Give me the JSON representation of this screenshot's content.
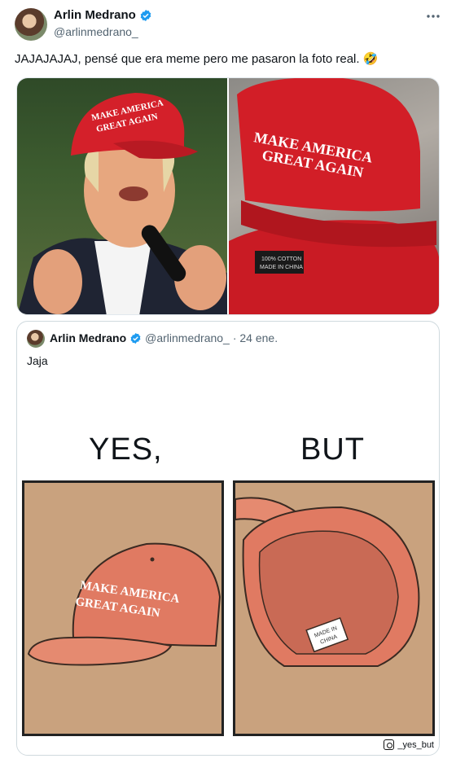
{
  "tweet": {
    "author_name": "Arlin Medrano",
    "handle": "@arlinmedrano_",
    "text": "JAJAJAJAJ, pensé que era meme pero me pasaron la foto real. 🤣",
    "more_icon": "more-icon",
    "verified_icon": "verified-badge-icon",
    "photos": [
      {
        "name": "man-speaking-in-red-cap",
        "cap_text": [
          "MAKE AMERICA",
          "GREAT AGAIN"
        ]
      },
      {
        "name": "red-cap-with-tag",
        "cap_text": [
          "MAKE AMERICA",
          "GREAT AGAIN"
        ],
        "tag_text": [
          "100% COTTON",
          "MADE IN CHINA"
        ]
      }
    ]
  },
  "quote": {
    "author_name": "Arlin Medrano",
    "handle": "@arlinmedrano_",
    "date": "· 24 ene.",
    "text": "Jaja",
    "comic": {
      "title_left": "YES,",
      "title_right": "BUT",
      "cap_text": [
        "MAKE AMERICA",
        "GREAT AGAIN"
      ],
      "tag_text": [
        "MADE IN",
        "CHINA"
      ],
      "credit": "_yes_but"
    }
  },
  "colors": {
    "verified_blue": "#1d9bf0",
    "cap_red": "#d4202a",
    "comic_cap": "#e07a62",
    "comic_bg": "#c9a27e"
  }
}
